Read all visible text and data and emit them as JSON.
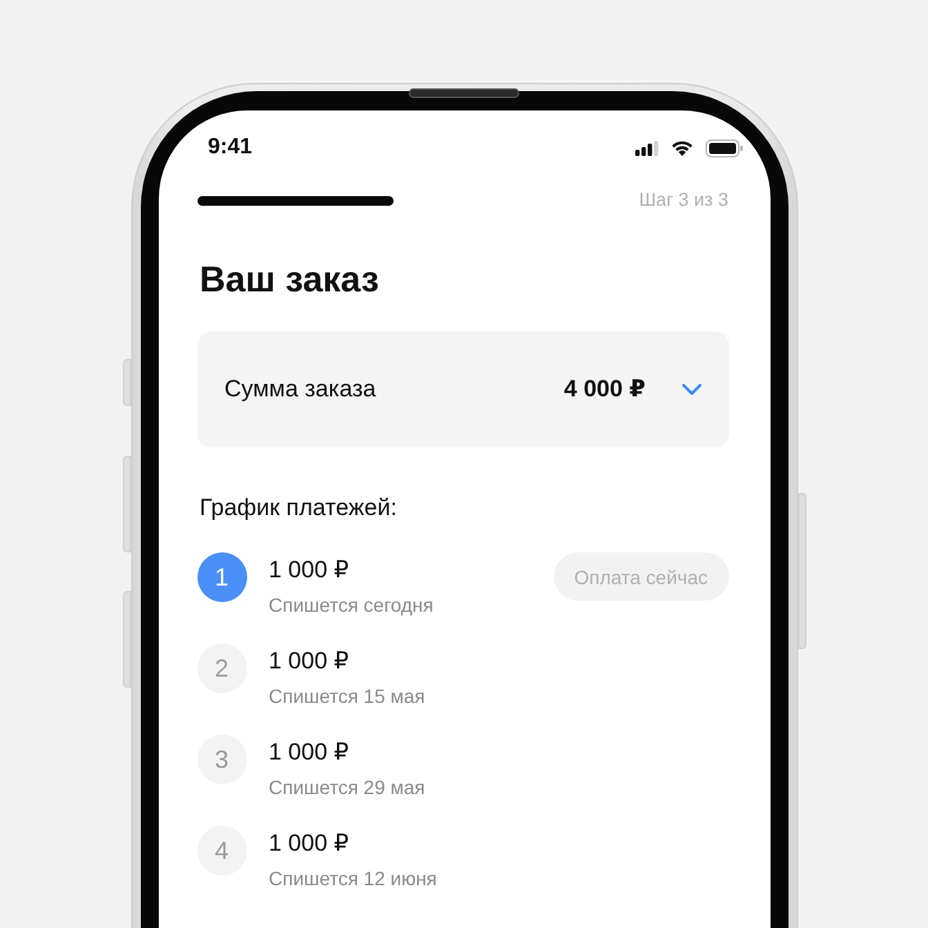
{
  "status_bar": {
    "time": "9:41"
  },
  "progress": {
    "step_label": "Шаг 3 из 3"
  },
  "title": "Ваш заказ",
  "order_sum": {
    "label": "Сумма заказа",
    "value": "4 000 ₽",
    "expanded": false
  },
  "schedule": {
    "heading": "График платежей:",
    "payments": [
      {
        "number": "1",
        "amount": "1 000 ₽",
        "date": "Спишется сегодня",
        "current": true,
        "badge": "Оплата сейчас"
      },
      {
        "number": "2",
        "amount": "1 000 ₽",
        "date": "Спишется 15 мая",
        "current": false
      },
      {
        "number": "3",
        "amount": "1 000 ₽",
        "date": "Спишется 29 мая",
        "current": false
      },
      {
        "number": "4",
        "amount": "1 000 ₽",
        "date": "Спишется 12 июня",
        "current": false
      }
    ]
  }
}
